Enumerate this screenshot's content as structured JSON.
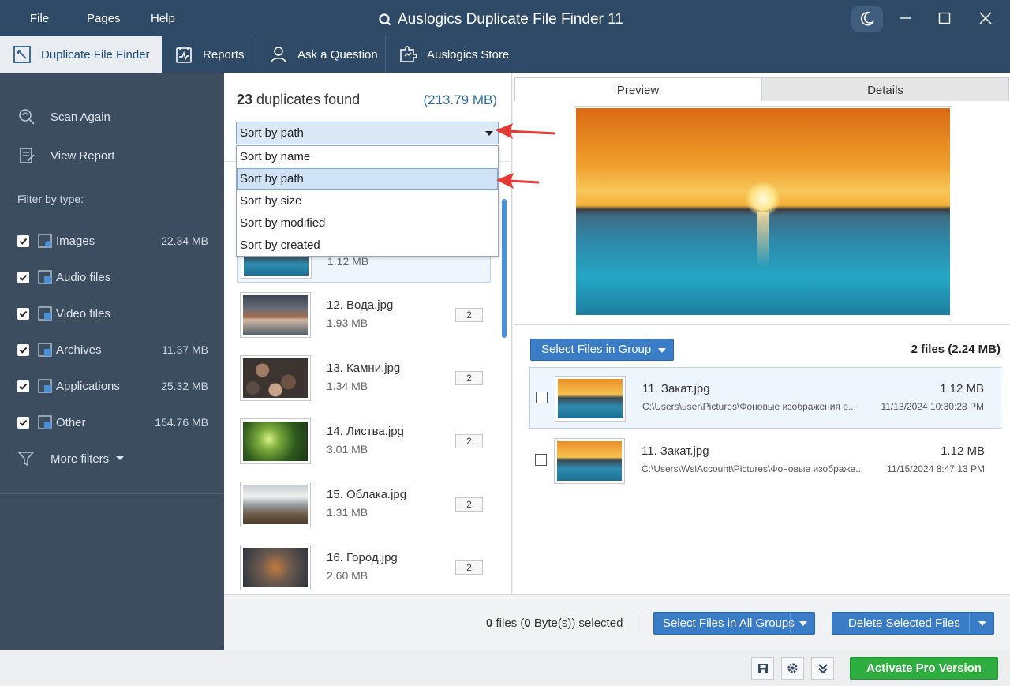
{
  "menu": {
    "file": "File",
    "pages": "Pages",
    "help": "Help"
  },
  "app_title": "Auslogics Duplicate File Finder 11",
  "tabs": [
    {
      "label": "Duplicate File Finder",
      "icon": "duplicate-finder-icon"
    },
    {
      "label": "Reports",
      "icon": "reports-icon"
    },
    {
      "label": "Ask a Question",
      "icon": "user-icon"
    },
    {
      "label": "Auslogics Store",
      "icon": "store-puzzle-icon"
    }
  ],
  "sidebar": {
    "scan_again": "Scan Again",
    "view_report": "View Report",
    "filter_title": "Filter by type:",
    "filters": [
      {
        "label": "Images",
        "size": "22.34 MB",
        "checked": true
      },
      {
        "label": "Audio files",
        "size": "",
        "checked": true
      },
      {
        "label": "Video files",
        "size": "",
        "checked": true
      },
      {
        "label": "Archives",
        "size": "11.37 MB",
        "checked": true
      },
      {
        "label": "Applications",
        "size": "25.32 MB",
        "checked": true
      },
      {
        "label": "Other",
        "size": "154.76 MB",
        "checked": true
      }
    ],
    "more_filters": "More filters"
  },
  "list": {
    "count": "23",
    "count_label": "duplicates found",
    "total_size": "(213.79 MB)",
    "sort_selected": "Sort by path",
    "sort_options": [
      "Sort by name",
      "Sort by path",
      "Sort by size",
      "Sort by modified",
      "Sort by created"
    ],
    "partial_item_size": "1.12 MB",
    "items": [
      {
        "name": "12. Вода.jpg",
        "size": "1.93 MB",
        "count": "2"
      },
      {
        "name": "13. Камни.jpg",
        "size": "1.34 MB",
        "count": "2"
      },
      {
        "name": "14. Листва.jpg",
        "size": "3.01 MB",
        "count": "2"
      },
      {
        "name": "15. Облака.jpg",
        "size": "1.31 MB",
        "count": "2"
      },
      {
        "name": "16. Город.jpg",
        "size": "2.60 MB",
        "count": "2"
      }
    ]
  },
  "preview": {
    "tab_preview": "Preview",
    "tab_details": "Details",
    "select_group_btn": "Select Files in Group",
    "files_count": "2 files (2.24 MB)",
    "group_files": [
      {
        "name": "11. Закат.jpg",
        "path": "C:\\Users\\user\\Pictures\\Фоновые изображения р...",
        "size": "1.12 MB",
        "date": "11/13/2024 10:30:28 PM"
      },
      {
        "name": "11. Закат.jpg",
        "path": "C:\\Users\\WsiAccount\\Pictures\\Фоновые изображе...",
        "size": "1.12 MB",
        "date": "11/15/2024 8:47:13 PM"
      }
    ]
  },
  "actions": {
    "sel_count": "0",
    "sel_files_label": "files (",
    "sel_bytes": "0",
    "sel_tail": "Byte(s)) selected",
    "select_all_groups": "Select Files in All Groups",
    "delete_selected": "Delete Selected Files"
  },
  "status": {
    "activate": "Activate Pro Version"
  },
  "colors": {
    "titlebar": "#2f4a66",
    "sidebar": "#3c4d60",
    "accent": "#3a7cc6",
    "activate": "#2eae3f",
    "annotation": "#e53935"
  }
}
